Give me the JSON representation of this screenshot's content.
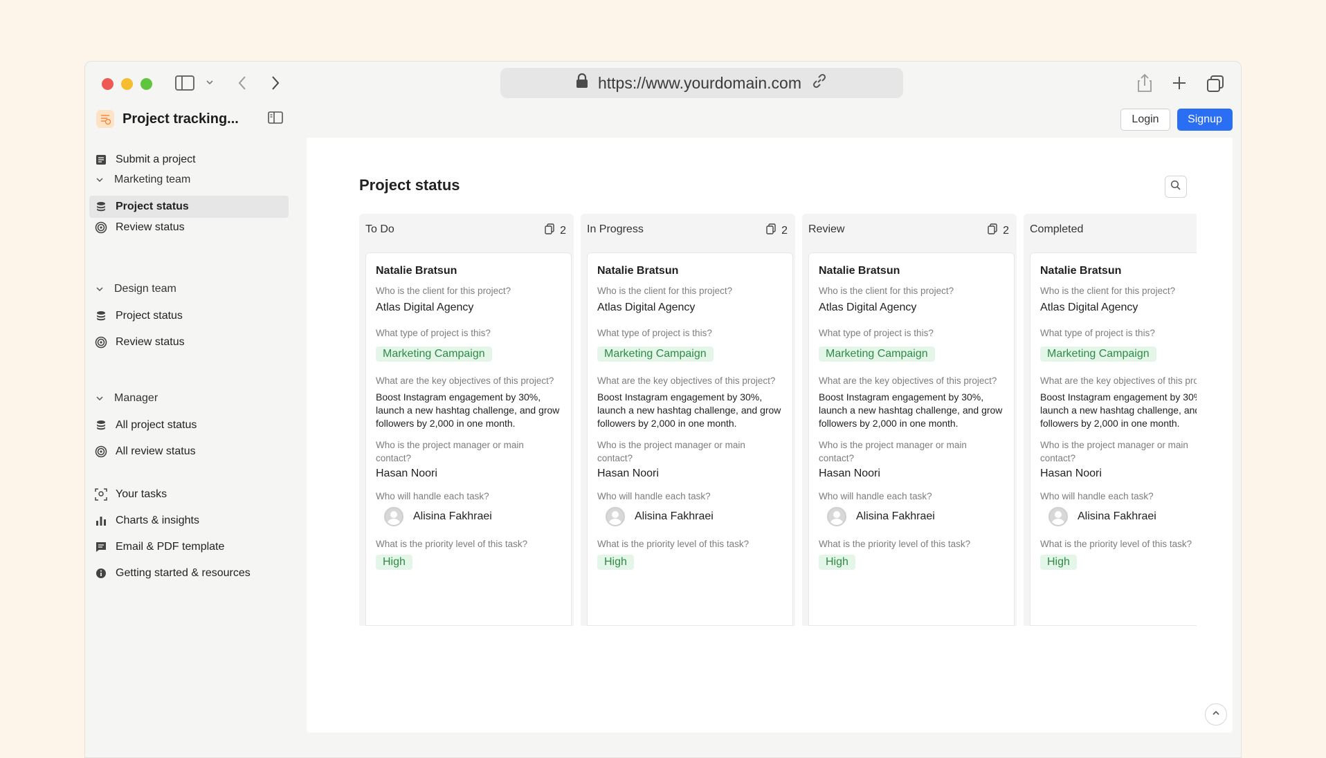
{
  "browser": {
    "url": "https://www.yourdomain.com"
  },
  "app": {
    "name": "Project tracking...",
    "login_label": "Login",
    "signup_label": "Signup"
  },
  "sidebar": {
    "submit": "Submit a project",
    "groups": [
      {
        "label": "Marketing team",
        "items": [
          "Project status",
          "Review status"
        ]
      },
      {
        "label": "Design team",
        "items": [
          "Project status",
          "Review status"
        ]
      },
      {
        "label": "Manager",
        "items": [
          "All project status",
          "All review status"
        ]
      }
    ],
    "bottom": [
      "Your tasks",
      "Charts & insights",
      "Email & PDF template",
      "Getting started & resources"
    ],
    "active_item": "Marketing team / Project status"
  },
  "main": {
    "title": "Project status",
    "columns": [
      {
        "title": "To Do",
        "count": "2"
      },
      {
        "title": "In Progress",
        "count": "2"
      },
      {
        "title": "Review",
        "count": "2"
      },
      {
        "title": "Completed",
        "count": ""
      }
    ],
    "card": {
      "name": "Natalie Bratsun",
      "q_client": "Who is the client for this project?",
      "a_client": "Atlas Digital Agency",
      "q_type": "What type of project is this?",
      "a_type": "Marketing Campaign",
      "q_objectives": "What are the key objectives of this project?",
      "a_objectives": "Boost Instagram engagement by 30%, launch a new hashtag challenge, and grow followers by 2,000 in one month.",
      "q_manager": "Who is the project manager or main contact?",
      "a_manager": "Hasan Noori",
      "q_handler": "Who will handle each task?",
      "a_handler": "Alisina Fakhraei",
      "q_priority": "What is the priority level of this task?",
      "a_priority": "High"
    }
  },
  "colors": {
    "accent": "#2a6ff3",
    "tag_bg": "#e3f6e8",
    "tag_text": "#2f8a47",
    "page_bg": "#fdf5ea"
  }
}
